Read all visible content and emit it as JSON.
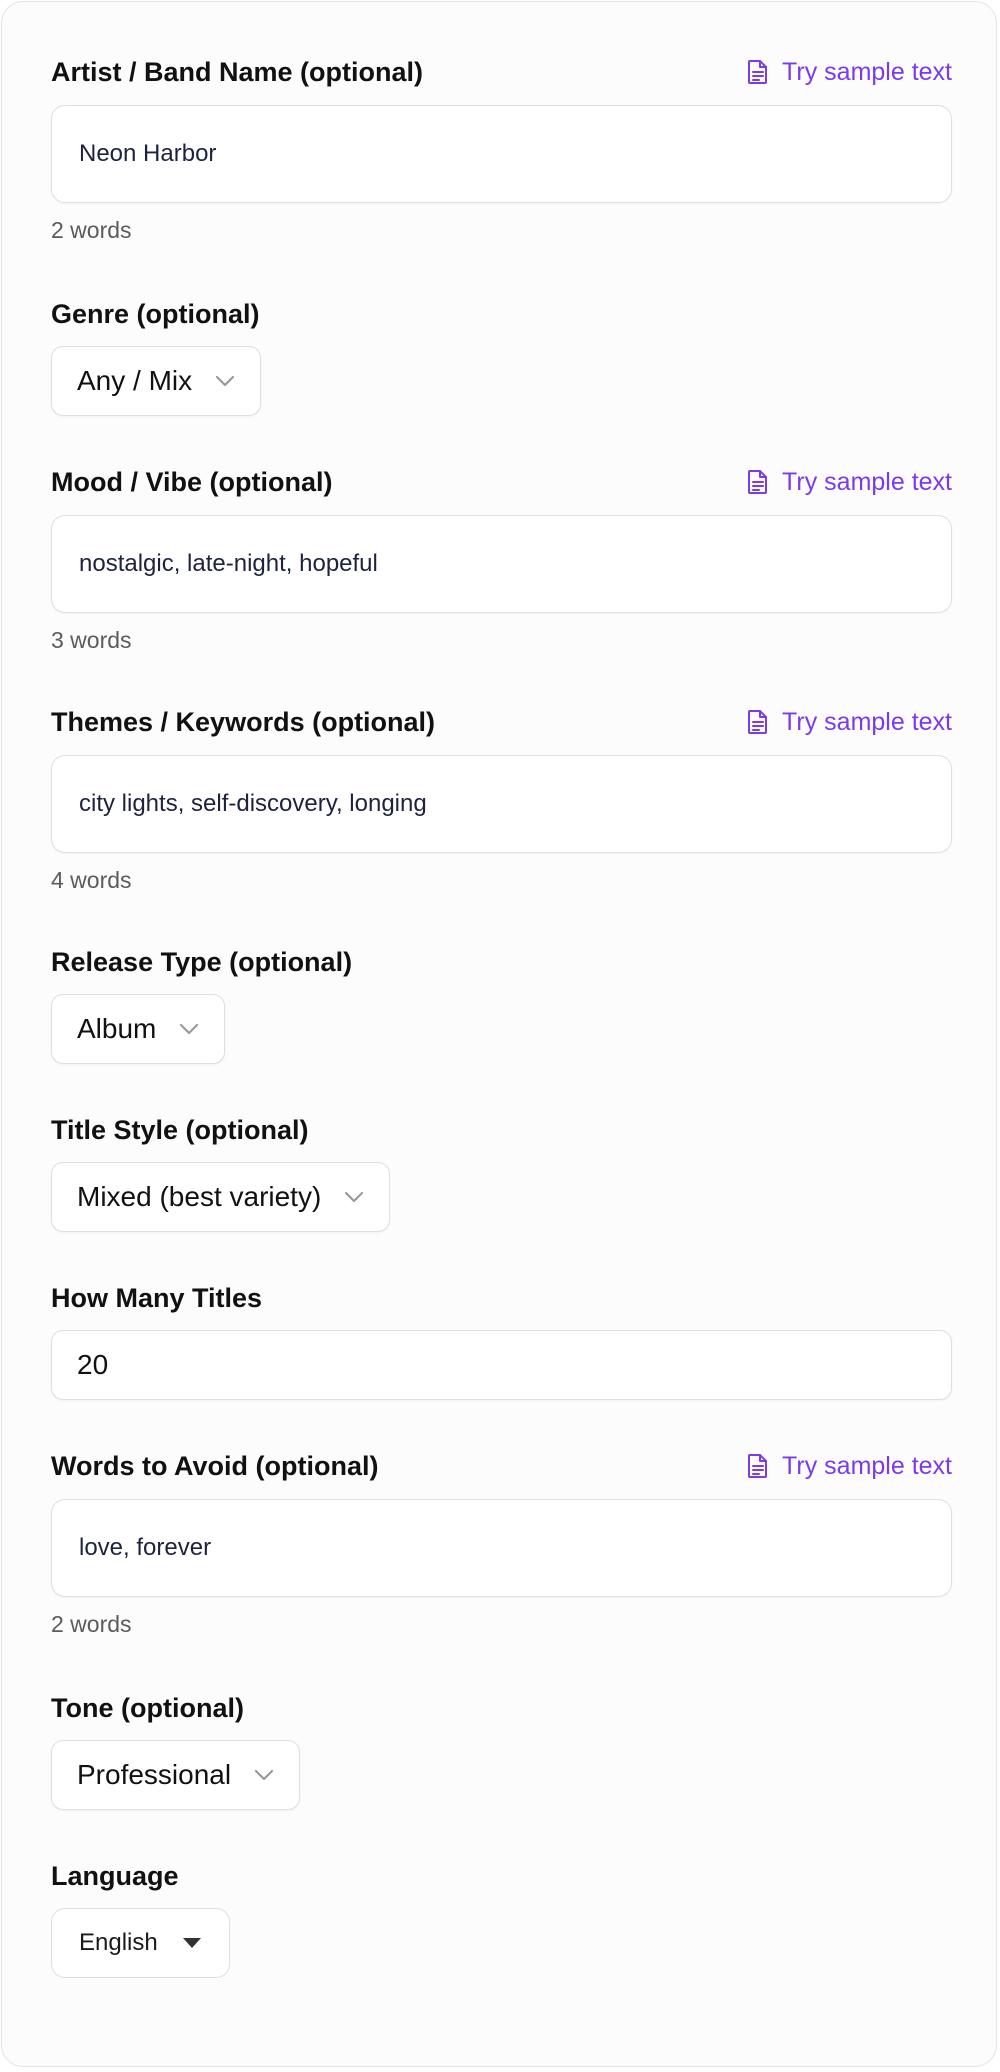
{
  "fields": {
    "artist": {
      "label": "Artist / Band Name (optional)",
      "sample_label": "Try sample text",
      "value": "Neon Harbor",
      "word_count": "2 words"
    },
    "genre": {
      "label": "Genre (optional)",
      "selected": "Any / Mix"
    },
    "mood": {
      "label": "Mood / Vibe (optional)",
      "sample_label": "Try sample text",
      "value": "nostalgic, late-night, hopeful",
      "word_count": "3 words"
    },
    "themes": {
      "label": "Themes / Keywords (optional)",
      "sample_label": "Try sample text",
      "value": "city lights, self-discovery, longing",
      "word_count": "4 words"
    },
    "release_type": {
      "label": "Release Type (optional)",
      "selected": "Album"
    },
    "title_style": {
      "label": "Title Style (optional)",
      "selected": "Mixed (best variety)"
    },
    "how_many": {
      "label": "How Many Titles",
      "value": "20"
    },
    "avoid": {
      "label": "Words to Avoid (optional)",
      "sample_label": "Try sample text",
      "value": "love, forever",
      "word_count": "2 words"
    },
    "tone": {
      "label": "Tone (optional)",
      "selected": "Professional"
    },
    "language": {
      "label": "Language",
      "selected": "English"
    }
  },
  "colors": {
    "accent": "#7c3aed",
    "border": "#dcdfe4",
    "muted_text": "#5b5b5b"
  },
  "icons": {
    "sample": "document-icon",
    "select": "chevron-down-icon",
    "native_select": "caret-down-icon"
  }
}
